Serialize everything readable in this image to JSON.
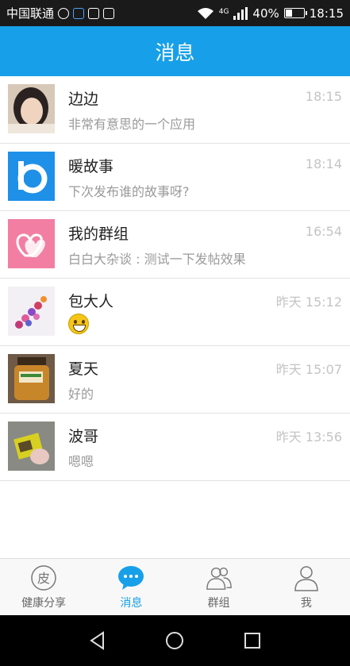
{
  "status_bar": {
    "carrier": "中国联通",
    "network": "4G",
    "battery": "40%",
    "battery_level": 0.4,
    "time": "18:15"
  },
  "header": {
    "title": "消息"
  },
  "conversations": [
    {
      "name": "边边",
      "preview": "非常有意思的一个应用",
      "time": "18:15"
    },
    {
      "name": "暖故事",
      "preview": "下次发布谁的故事呀?",
      "time": "18:14"
    },
    {
      "name": "我的群组",
      "preview": "白白大杂谈 : 测试一下发帖效果",
      "time": "16:54"
    },
    {
      "name": "包大人",
      "preview": "",
      "time": "昨天 15:12",
      "preview_icon": "smiley-emoji-icon"
    },
    {
      "name": "夏天",
      "preview": "好的",
      "time": "昨天 15:07"
    },
    {
      "name": "波哥",
      "preview": "嗯嗯",
      "time": "昨天 13:56"
    }
  ],
  "tabs": [
    {
      "label": "健康分享",
      "icon": "skin-badge-icon",
      "icon_char": "皮"
    },
    {
      "label": "消息",
      "icon": "chat-bubble-icon",
      "active": true
    },
    {
      "label": "群组",
      "icon": "group-icon"
    },
    {
      "label": "我",
      "icon": "person-icon"
    }
  ],
  "colors": {
    "accent": "#17a0e9",
    "status_bar": "#1a1a1a",
    "nav_bar": "#000000"
  }
}
